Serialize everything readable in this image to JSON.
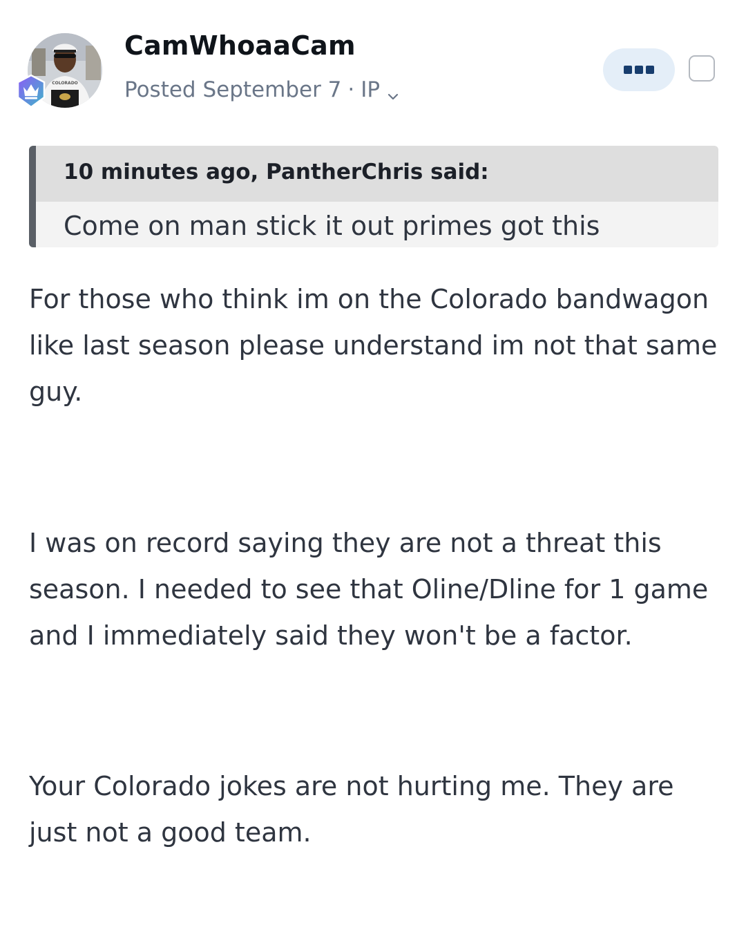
{
  "author": {
    "name": "CamWhoaaCam",
    "avatar_icon": "user-avatar-icon",
    "badge_icon": "crown-rank-badge-icon",
    "avatar_jersey_text": "COLORADO"
  },
  "meta": {
    "posted": "Posted September 7",
    "separator": "·",
    "ip_label": "IP",
    "dropdown_icon": "chevron-down-icon"
  },
  "actions": {
    "more_icon": "more-options-icon",
    "select_icon": "checkbox-icon"
  },
  "quote": {
    "citation": "10 minutes ago, PantherChris said:",
    "text": "Come on man stick it out primes got this"
  },
  "body": {
    "paragraphs": [
      "For those who think im on the Colorado bandwagon like last season please understand im not that same guy.",
      "I was on record saying they are not a threat this season. I needed to see that Oline/Dline for 1 game and I immediately said they won't be a factor.",
      "Your Colorado jokes are not hurting me. They are just not a good team."
    ]
  },
  "colors": {
    "accent": "#173d6e",
    "more_button_bg": "#e4eef8",
    "meta_text": "#6a7688",
    "quote_bar": "#5a5f66",
    "badge_gradient_start": "#8b5cf6",
    "badge_gradient_end": "#3fb6c8"
  }
}
